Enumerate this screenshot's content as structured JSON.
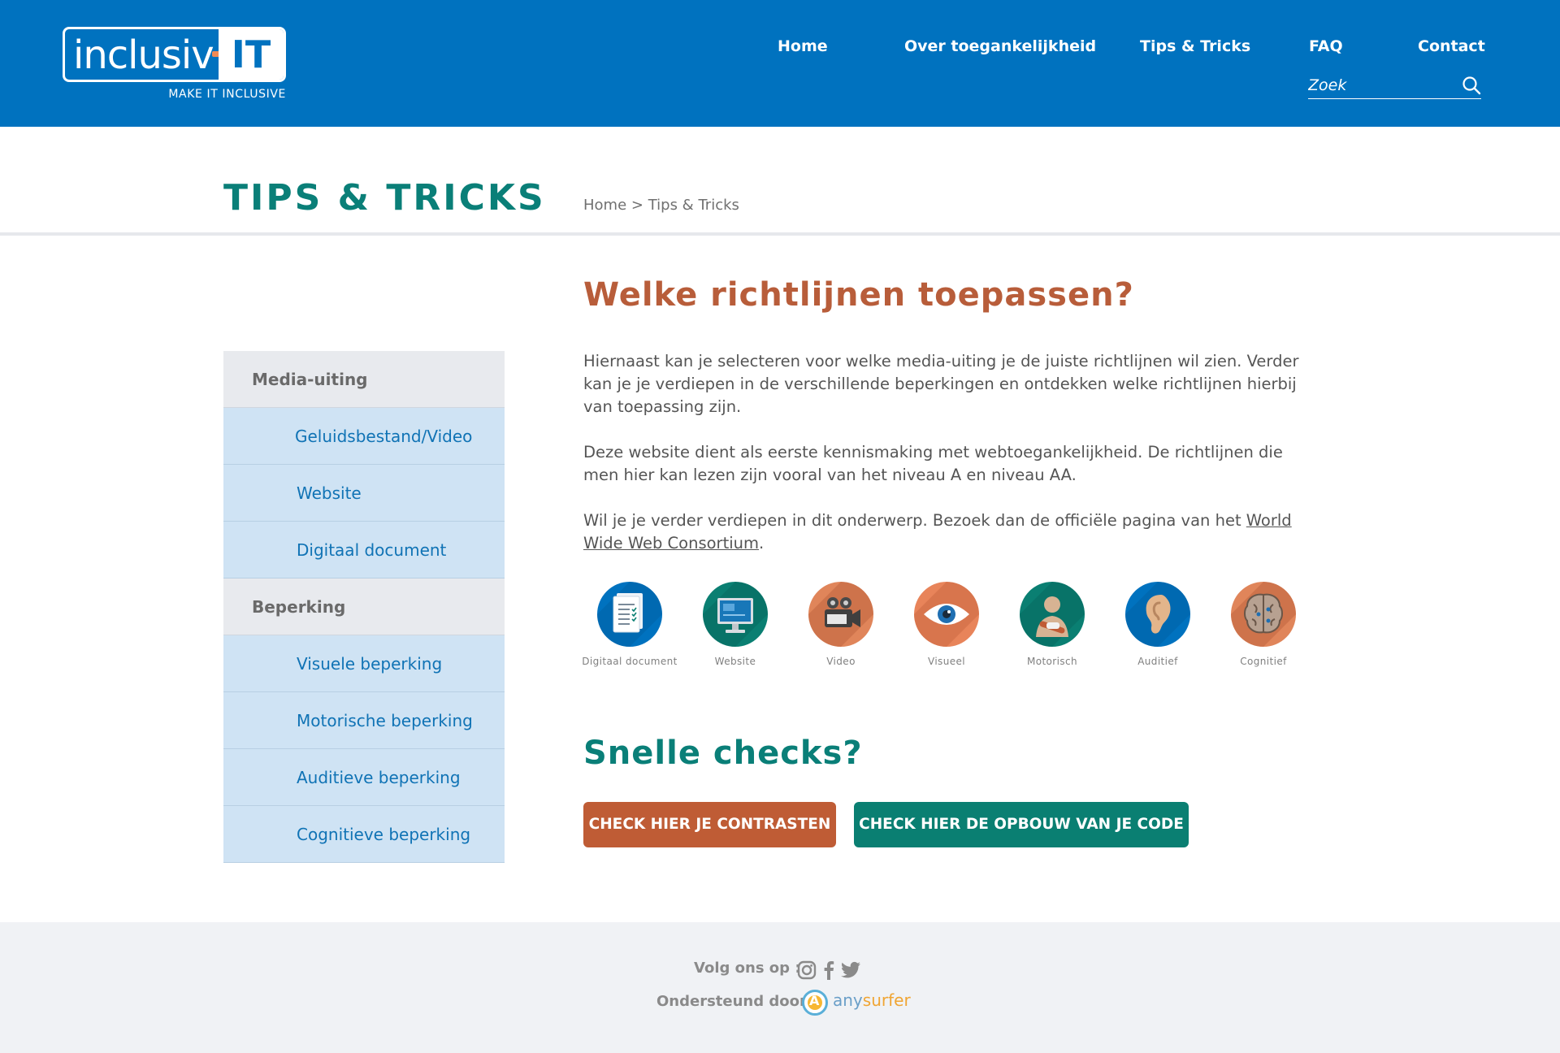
{
  "header": {
    "logo": {
      "text": "inclusiv",
      "highlight": "IT",
      "tagline": "MAKE IT INCLUSIVE"
    },
    "nav": [
      {
        "label": "Home"
      },
      {
        "label": "Over toegankelijkheid"
      },
      {
        "label": "Tips & Tricks"
      },
      {
        "label": "FAQ"
      },
      {
        "label": "Contact"
      }
    ],
    "search": {
      "placeholder": "Zoek",
      "value": "",
      "icon": "search-icon"
    }
  },
  "page": {
    "title": "TIPS & TRICKS",
    "breadcrumb": {
      "home": "Home",
      "separator": ">",
      "current": "Tips & Tricks"
    }
  },
  "sidebar": {
    "groups": [
      {
        "label": "Media-uiting",
        "items": [
          "Geluidsbestand/Video",
          "Website",
          "Digitaal document"
        ]
      },
      {
        "label": "Beperking",
        "items": [
          "Visuele beperking",
          "Motorische beperking",
          "Auditieve beperking",
          "Cognitieve beperking"
        ]
      }
    ]
  },
  "content": {
    "heading": "Welke richtlijnen toepassen?",
    "paragraphs": [
      "Hiernaast kan je selecteren voor welke media-uiting je de juiste richtlijnen wil zien. Verder kan je je verdiepen in de verschillende beperkingen en ontdekken welke richtlijnen hierbij van toepassing zijn.",
      "Deze website dient als eerste kennismaking met webtoegankelijkheid. De richtlijnen die men hier kan lezen zijn vooral van het niveau A en niveau AA."
    ],
    "paragraph3": {
      "before": "Wil je je verder verdiepen in dit onderwerp. Bezoek dan de officiële pagina van het ",
      "link": "World Wide Web Consortium",
      "after": "."
    },
    "icons": [
      {
        "label": "Digitaal document",
        "icon": "document-icon",
        "color": "#0072bf"
      },
      {
        "label": "Website",
        "icon": "monitor-icon",
        "color": "#0a7f72"
      },
      {
        "label": "Video",
        "icon": "video-camera-icon",
        "color": "#e0855a"
      },
      {
        "label": "Visueel",
        "icon": "eye-icon",
        "color": "#e8845a"
      },
      {
        "label": "Motorisch",
        "icon": "person-arm-sling-icon",
        "color": "#0a7f72"
      },
      {
        "label": "Auditief",
        "icon": "ear-icon",
        "color": "#0072bf"
      },
      {
        "label": "Cognitief",
        "icon": "brain-icon",
        "color": "#e0855a"
      }
    ],
    "subheading": "Snelle checks?",
    "buttons": {
      "contrast": "CHECK HIER JE CONTRASTEN",
      "code": "CHECK HIER DE OPBOUW VAN JE CODE"
    }
  },
  "footer": {
    "follow_label": "Volg ons op :",
    "social": [
      "instagram-icon",
      "facebook-icon",
      "twitter-icon"
    ],
    "support_label": "Ondersteund door",
    "sponsor": {
      "any": "any",
      "surfer": "surfer",
      "badge": "A"
    }
  },
  "colors": {
    "brand_blue": "#0072bf",
    "teal": "#0a7f78",
    "orange": "#bf5c35",
    "sidebar_item_bg": "#cfe3f4"
  }
}
